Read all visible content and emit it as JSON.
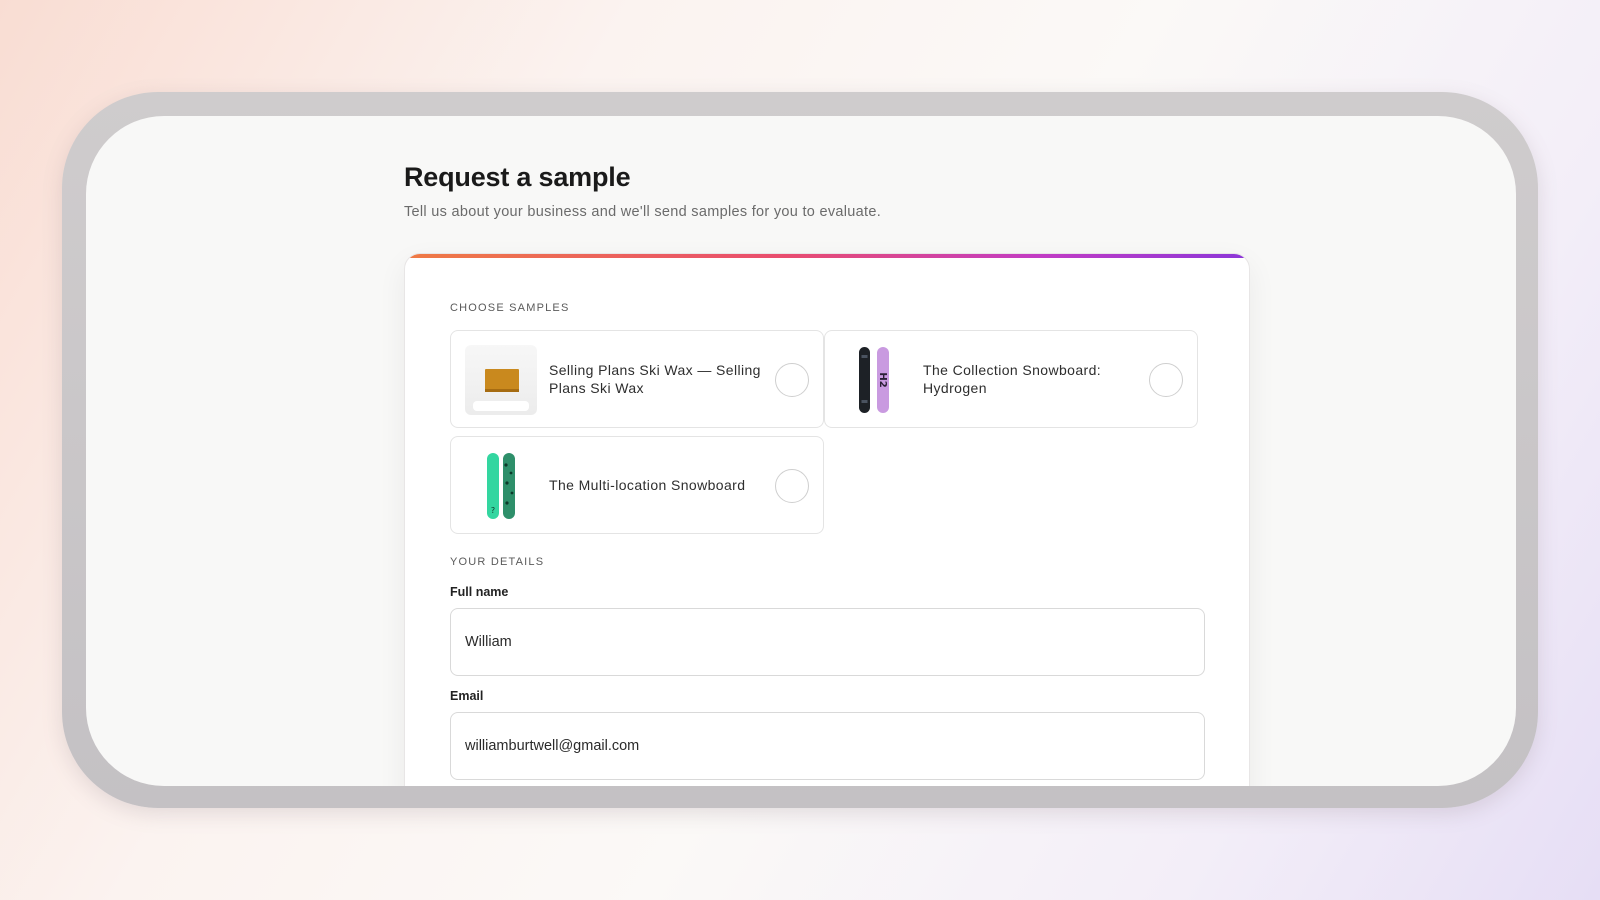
{
  "page": {
    "title": "Request a sample",
    "subtitle": "Tell us about your business and we'll send samples for you to evaluate."
  },
  "form": {
    "samples_section_label": "CHOOSE SAMPLES",
    "samples": [
      {
        "title": "Selling Plans Ski Wax — Selling Plans Ski Wax",
        "icon": "ski-wax-image",
        "selected": false
      },
      {
        "title": "The Collection Snowboard: Hydrogen",
        "icon": "snowboard-hydrogen-image",
        "selected": false
      },
      {
        "title": "The Multi-location Snowboard",
        "icon": "snowboard-multilocation-image",
        "selected": false
      }
    ],
    "details_section_label": "YOUR DETAILS",
    "full_name": {
      "label": "Full name",
      "value": "William"
    },
    "email": {
      "label": "Email",
      "value": "williamburtwell@gmail.com"
    }
  },
  "colors": {
    "accent_gradient": [
      "#ef7b45",
      "#e94d6f",
      "#c23cc4",
      "#8c37d8"
    ]
  }
}
